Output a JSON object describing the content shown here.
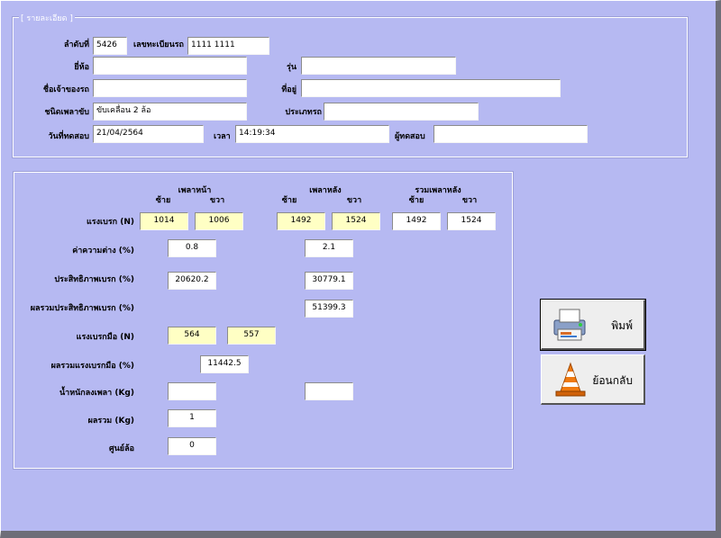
{
  "vehicle_group": {
    "legend": "[ รายละเอียด ]",
    "seq_label": "ลำดับที่",
    "seq_value": "5426",
    "plate_label": "เลขทะเบียนรถ",
    "plate_value": "1111 1111",
    "brand_label": "ยี่ห้อ",
    "brand_value": "",
    "model_label": "รุ่น",
    "model_value": "",
    "owner_label": "ชื่อเจ้าของรถ",
    "owner_value": "",
    "address_label": "ที่อยู่",
    "address_value": "",
    "drive_label": "ชนิดเพลาขับ",
    "drive_value": "ขับเคลื่อน 2 ล้อ",
    "type_label": "ประเภทรถ",
    "type_value": "",
    "date_label": "วันที่ทดสอบ",
    "date_value": "21/04/2564",
    "time_label": "เวลา",
    "time_value": "14:19:34",
    "tester_label": "ผู้ทดสอบ",
    "tester_value": ""
  },
  "results": {
    "front_axle": "เพลาหน้า",
    "rear_axle": "เพลาหลัง",
    "total_rear": "รวมเพลาหลัง",
    "left": "ซ้าย",
    "right": "ขวา",
    "brake_force_label": "แรงเบรก (N)",
    "brake_force": {
      "front_left": "1014",
      "front_right": "1006",
      "rear_left": "1492",
      "rear_right": "1524",
      "total_left": "1492",
      "total_right": "1524"
    },
    "diff_label": "ค่าความต่าง (%)",
    "diff_front": "0.8",
    "diff_rear": "2.1",
    "eff_label": "ประสิทธิภาพเบรก (%)",
    "eff_front": "20620.2",
    "eff_rear": "30779.1",
    "sum_eff_label": "ผลรวมประสิทธิภาพเบรก (%)",
    "sum_eff": "51399.3",
    "hand_label": "แรงเบรกมือ (N)",
    "hand_left": "564",
    "hand_right": "557",
    "sum_hand_label": "ผลรวมแรงเบรกมือ (%)",
    "sum_hand": "11442.5",
    "axle_weight_label": "น้ำหนักลงเพลา (Kg)",
    "axle_weight_front": "",
    "axle_weight_rear": "",
    "total_label": "ผลรวม (Kg)",
    "total_value": "1",
    "wheel_align_label": "ศูนย์ล้อ",
    "wheel_align_value": "0"
  },
  "buttons": {
    "print_label": "พิมพ์",
    "print_icon": "printer-icon",
    "back_label": "ย้อนกลับ",
    "back_icon": "traffic-cone-icon"
  }
}
